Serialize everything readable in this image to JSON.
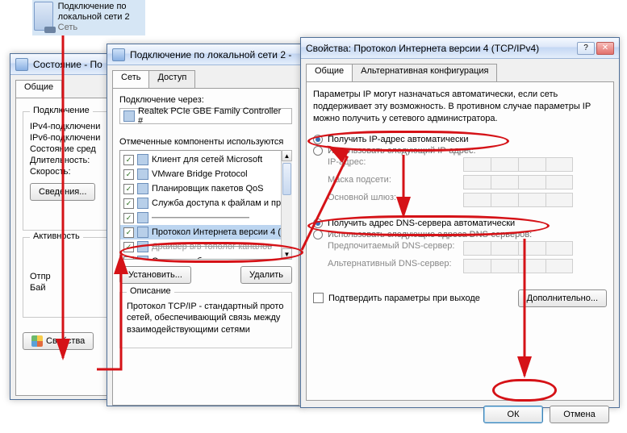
{
  "desktop": {
    "name": "Подключение по локальной сети 2",
    "type": "Сеть"
  },
  "status_win": {
    "title": "Состояние - По",
    "tab_general": "Общие",
    "grp_connection": "Подключение",
    "rows": {
      "ipv4": "IPv4-подключени",
      "ipv6": "IPv6-подключени",
      "media": "Состояние сред",
      "duration": "Длительность:",
      "speed": "Скорость:"
    },
    "details_btn": "Сведения...",
    "grp_activity": "Активность",
    "sent_lbl": "Отпр",
    "bytes_lbl": "Бай",
    "properties_btn": "Свойства"
  },
  "props_win": {
    "title": "Подключение по локальной сети 2 -",
    "tab_net": "Сеть",
    "tab_access": "Доступ",
    "connect_using": "Подключение через:",
    "adapter": "Realtek PCIe GBE Family Controller #",
    "components_label": "Отмеченные компоненты используются",
    "items": [
      "Клиент для сетей Microsoft",
      "VMware Bridge Protocol",
      "Планировщик пакетов QoS",
      "Служба доступа к файлам и при",
      "Протокол Интернета версии 4 (",
      "Драйвер в/в тополог каналов",
      "Ответчик обнаружения тополог"
    ],
    "install_btn": "Установить...",
    "remove_btn": "Удалить",
    "desc_legend": "Описание",
    "desc_text": "Протокол TCP/IP - стандартный прото сетей, обеспечивающий связь между взаимодействующими сетями"
  },
  "ipv4_win": {
    "title": "Свойства: Протокол Интернета версии 4 (TCP/IPv4)",
    "tab_general": "Общие",
    "tab_alt": "Альтернативная конфигурация",
    "intro": "Параметры IP могут назначаться автоматически, если сеть поддерживает эту возможность. В противном случае параметры IP можно получить у сетевого администратора.",
    "radio_ip_auto": "Получить IP-адрес автоматически",
    "radio_ip_manual": "Использовать следующий IP-адрес:",
    "lbl_ip": "IP-адрес:",
    "lbl_mask": "Маска подсети:",
    "lbl_gw": "Основной шлюз:",
    "radio_dns_auto": "Получить адрес DNS-сервера автоматически",
    "radio_dns_manual": "Использовать следующие адреса DNS-серверов:",
    "lbl_dns1": "Предпочитаемый DNS-сервер:",
    "lbl_dns2": "Альтернативный DNS-сервер:",
    "validate": "Подтвердить параметры при выходе",
    "advanced_btn": "Дополнительно...",
    "ok_btn": "ОК",
    "cancel_btn": "Отмена"
  }
}
